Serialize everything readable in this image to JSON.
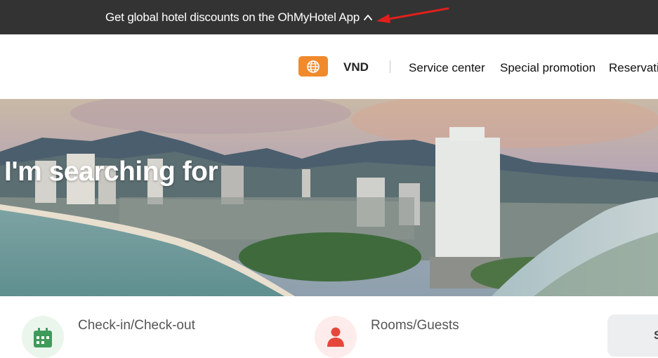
{
  "promo_bar": {
    "text": "Get global hotel discounts on the OhMyHotel App",
    "collapse_icon": "chevron-up-icon",
    "annotation_icon": "red-arrow-icon"
  },
  "header": {
    "language_icon": "globe-icon",
    "currency": "VND",
    "nav": [
      {
        "label": "Service center"
      },
      {
        "label": "Special promotion"
      },
      {
        "label": "Reservation"
      }
    ]
  },
  "hero": {
    "title": "I'm searching for"
  },
  "search_form": {
    "dates": {
      "icon": "calendar-icon",
      "label": "Check-in/Check-out",
      "value": ""
    },
    "rooms": {
      "icon": "person-icon",
      "label": "Rooms/Guests",
      "value": ""
    },
    "search_label": "S"
  },
  "colors": {
    "promo_bg": "#333333",
    "accent": "#f08a2c",
    "calendar_green": "#3f9b5a",
    "person_red": "#e5483b"
  }
}
